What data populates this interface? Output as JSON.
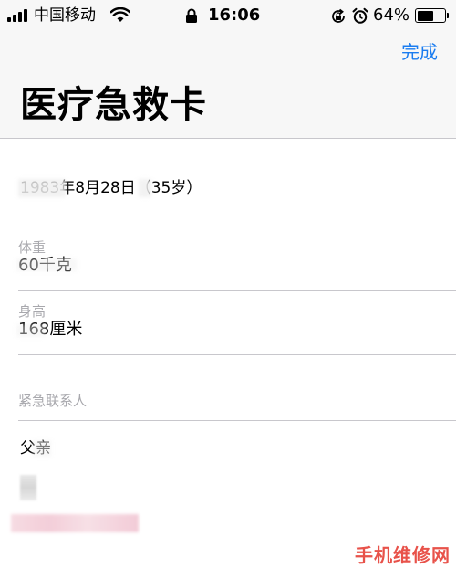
{
  "status_bar": {
    "carrier": "中国移动",
    "time": "16:06",
    "battery_percent": "64%",
    "battery_level": 0.64,
    "icons": [
      "signal-icon",
      "wifi-icon",
      "lock-icon",
      "rotation-lock-icon",
      "alarm-icon",
      "battery-icon"
    ]
  },
  "nav": {
    "done_label": "完成",
    "title": "医疗急救卡"
  },
  "profile": {
    "birthday": "1983年8月28日（35岁）"
  },
  "fields": [
    {
      "label": "体重",
      "value": "60千克"
    },
    {
      "label": "身高",
      "value": "168厘米"
    }
  ],
  "emergency": {
    "label": "紧急联系人",
    "contact_name": "父亲"
  },
  "watermark": "手机维修网",
  "colors": {
    "accent": "#1a7cf0",
    "label_gray": "#a8a8ad",
    "divider": "#c8c7cc",
    "header_bg": "#f7f7f7",
    "watermark": "#e8524a"
  }
}
